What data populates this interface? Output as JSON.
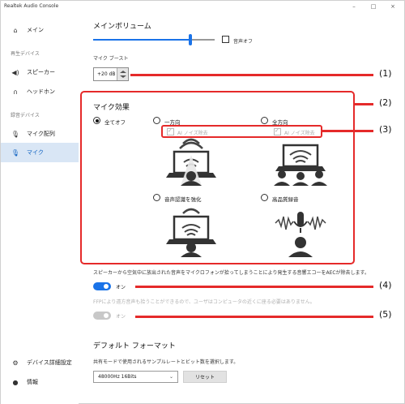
{
  "window": {
    "title": "Realtek Audio Console",
    "minimize": "–",
    "maximize": "□",
    "close": "×"
  },
  "sidebar": {
    "items": [
      {
        "label": "メイン",
        "icon": "home-icon"
      },
      {
        "label": "スピーカー",
        "icon": "speaker-icon"
      },
      {
        "label": "ヘッドホン",
        "icon": "headphones-icon"
      },
      {
        "label": "マイク配列",
        "icon": "mic-icon"
      },
      {
        "label": "マイク",
        "icon": "mic-icon"
      },
      {
        "label": "デバイス詳細設定",
        "icon": "gear-icon"
      },
      {
        "label": "情報",
        "icon": "info-icon"
      }
    ],
    "sections": {
      "playback": "再生デバイス",
      "recording": "録音デバイス"
    }
  },
  "main": {
    "volume_title": "メインボリューム",
    "volume_level": 0.8,
    "mute_label": "音声オフ",
    "boost_label": "マイク ブースト",
    "boost_value": "+20 dB",
    "effects_title": "マイク効果",
    "effects": [
      {
        "label": "全てオフ",
        "selected": true
      },
      {
        "label": "一方向",
        "selected": false
      },
      {
        "label": "全方向",
        "selected": false
      },
      {
        "label": "音声認識を強化",
        "selected": false
      },
      {
        "label": "高品質録音",
        "selected": false
      }
    ],
    "ai_noise_label": "AI ノイズ除去",
    "aec_note": "スピーカーから空気中に放出された音声をマイクロフォンが拾ってしまうことにより発生する音響エコーをAECが除去します。",
    "aec_toggle_label": "オン",
    "ffp_note": "FFPにより遠方音声も拾うことができるので、ユーザはコンピュータの近くに座る必要はありません。",
    "ffp_toggle_label": "オン",
    "format_title": "デフォルト フォーマット",
    "format_note": "共有モードで使用されるサンプルレートとビット数を選択します。",
    "format_value": "48000Hz 16Bits",
    "reset_label": "リセット"
  },
  "callouts": [
    "(1)",
    "(2)",
    "(3)",
    "(4)",
    "(5)"
  ],
  "colors": {
    "accent": "#1a73e8",
    "highlight": "#e52a2a",
    "active_nav_bg": "#d9e6f5"
  }
}
